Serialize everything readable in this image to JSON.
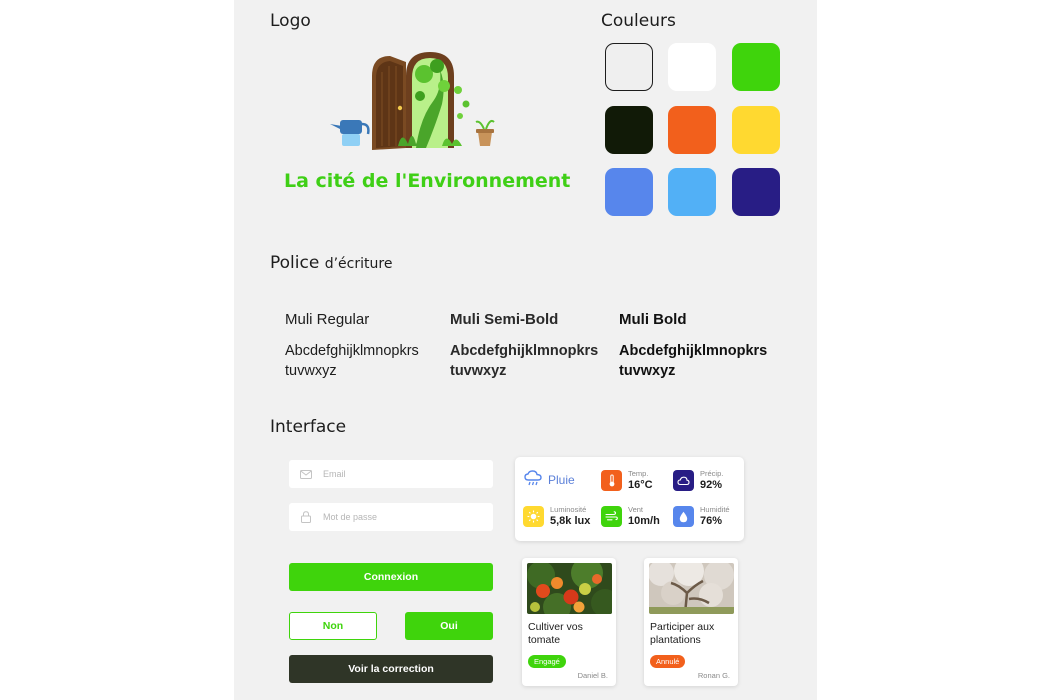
{
  "sections": {
    "logo": "Logo",
    "colors": "Couleurs",
    "font_main": "Police",
    "font_small": "d’écriture",
    "interface": "Interface"
  },
  "brand": {
    "name": "La cité de l'Environnement"
  },
  "colors": [
    "#efefef",
    "#ffffff",
    "#3fd40c",
    "#111a07",
    "#f2601c",
    "#ffd930",
    "#5786ec",
    "#52b0f6",
    "#281d85"
  ],
  "fonts": [
    {
      "name": "Muli Regular",
      "sample_1": "Abcdefghijklmnopkrs",
      "sample_2": "tuvwxyz"
    },
    {
      "name": "Muli Semi-Bold",
      "sample_1": "Abcdefghijklmnopkrs",
      "sample_2": "tuvwxyz"
    },
    {
      "name": "Muli Bold",
      "sample_1": "Abcdefghijklmnopkrs",
      "sample_2": "tuvwxyz"
    }
  ],
  "login": {
    "email_placeholder": "Email",
    "email_value": "",
    "password_placeholder": "Mot de passe",
    "password_value": "",
    "connect_label": "Connexion",
    "no_label": "Non",
    "yes_label": "Oui",
    "correction_label": "Voir la correction"
  },
  "weather": {
    "condition": "Pluie",
    "temp_label": "Temp.",
    "temp_value": "16°C",
    "precip_label": "Précip.",
    "precip_value": "92%",
    "light_label": "Luminosité",
    "light_value": "5,8k lux",
    "wind_label": "Vent",
    "wind_value": "10m/h",
    "humidity_label": "Humidité",
    "humidity_value": "76%",
    "icon_colors": {
      "temp": "#f2601c",
      "precip": "#281d85",
      "light": "#ffd930",
      "wind": "#3fd40c",
      "humidity": "#5786ec"
    }
  },
  "cards": [
    {
      "title": "Cultiver vos tomate",
      "badge": "Engagé",
      "badge_color": "#3fd40c",
      "author": "Daniel B."
    },
    {
      "title": "Participer aux plantations",
      "badge": "Annulé",
      "badge_color": "#f2601c",
      "author": "Ronan G."
    }
  ]
}
